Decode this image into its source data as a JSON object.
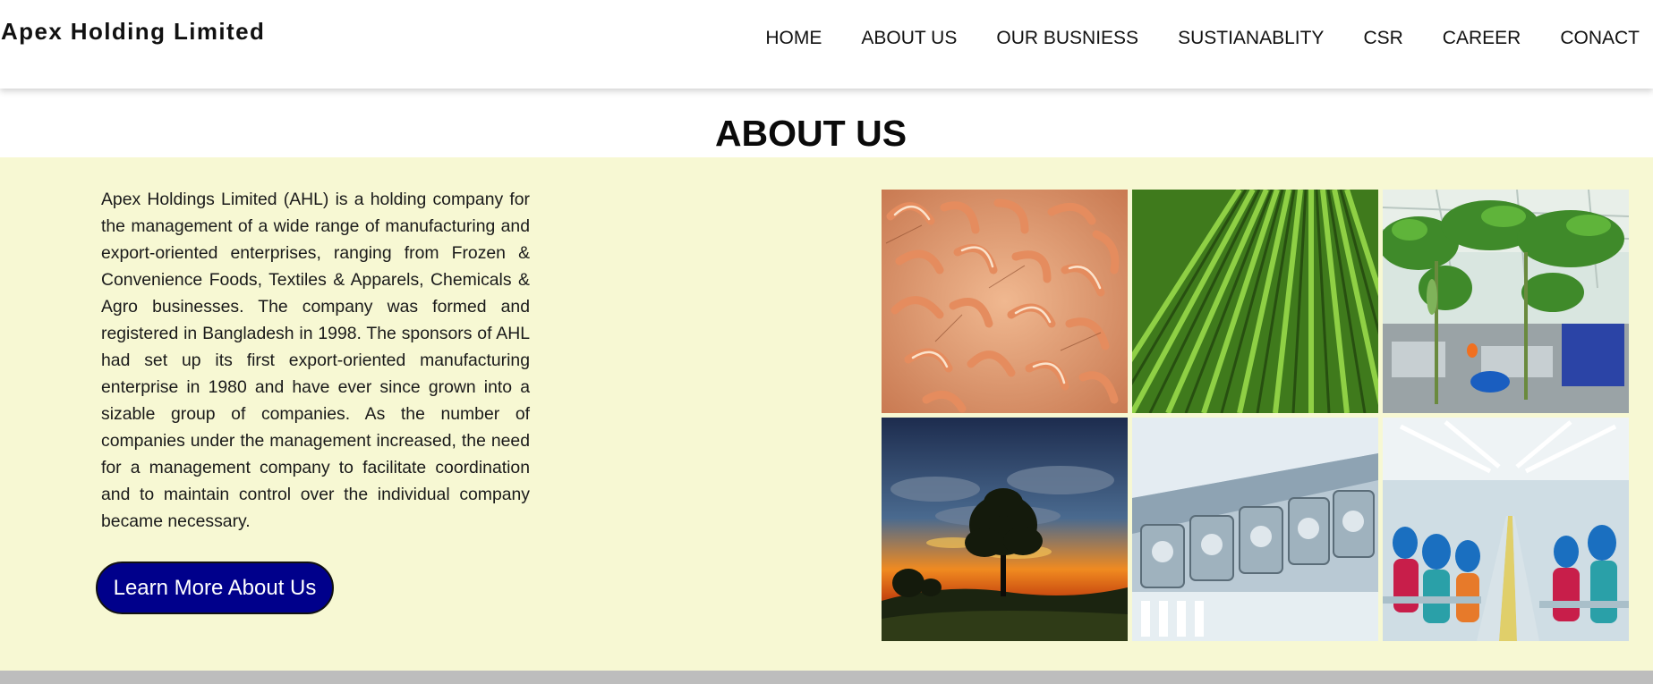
{
  "brand": "Apex Holding Limited",
  "nav": [
    "HOME",
    "ABOUT US",
    "OUR BUSNIESS",
    "SUSTIANABLITY",
    "CSR",
    "CAREER",
    "CONACT"
  ],
  "about": {
    "title": "ABOUT US",
    "paragraph": "Apex Holdings Limited (AHL) is a holding company for the management of a wide range of manufacturing and export-oriented enterprises, ranging from Frozen & Convenience Foods, Textiles & Apparels, Chemicals & Agro businesses. The company was formed and registered in Bangladesh in 1998. The sponsors of AHL had set up its first export-oriented manufacturing enterprise in 1980 and have ever since grown into a sizable group of companies. As the number of companies under the management increased, the need for a management company to facilitate coordination and to maintain control over the individual company became necessary.",
    "button_label": "Learn More About Us",
    "images": [
      "shrimp-image",
      "crop-field-image",
      "greenhouse-image",
      "sunset-tree-image",
      "textile-machinery-image",
      "garment-factory-image"
    ]
  },
  "colors": {
    "band_background": "#f7f8d3",
    "button_background": "#00008b",
    "footer_bar": "#bdbdbd"
  }
}
